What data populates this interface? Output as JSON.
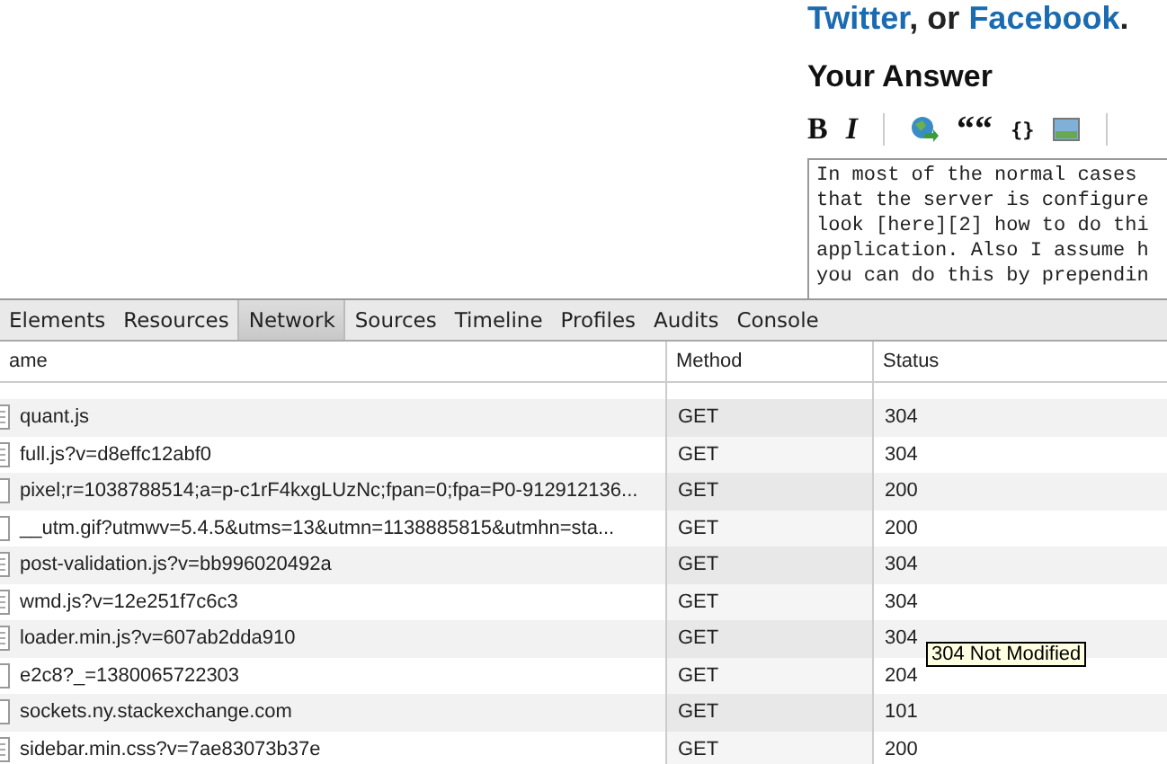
{
  "page": {
    "share_links": [
      {
        "text": "Twitter"
      },
      {
        "text": ", or "
      },
      {
        "text": "Facebook"
      },
      {
        "text": "."
      }
    ],
    "heading": "Your Answer",
    "toolbar": [
      {
        "kind": "bold",
        "label": "B"
      },
      {
        "kind": "italic",
        "label": "I"
      },
      {
        "kind": "separator"
      },
      {
        "kind": "link"
      },
      {
        "kind": "quote",
        "label": "“"
      },
      {
        "kind": "code",
        "label": "{}"
      },
      {
        "kind": "image"
      },
      {
        "kind": "separator"
      }
    ],
    "answer_lines": [
      "In most of the normal cases",
      "that the server is configure",
      "look [here][2] how to do thi",
      "application. Also I assume h",
      "you can do this by prependin"
    ]
  },
  "devtools": {
    "tabs": [
      {
        "label": "Elements",
        "selected": false
      },
      {
        "label": "Resources",
        "selected": false
      },
      {
        "label": "Network",
        "selected": true
      },
      {
        "label": "Sources",
        "selected": false
      },
      {
        "label": "Timeline",
        "selected": false
      },
      {
        "label": "Profiles",
        "selected": false
      },
      {
        "label": "Audits",
        "selected": false
      },
      {
        "label": "Console",
        "selected": false
      }
    ],
    "columns": [
      "ame",
      "Method",
      "Status"
    ],
    "rows": [
      {
        "kind": "script",
        "name": "quant.js",
        "method": "GET",
        "status": "304"
      },
      {
        "kind": "script",
        "name": "full.js?v=d8effc12abf0",
        "method": "GET",
        "status": "304"
      },
      {
        "kind": "other",
        "name": "pixel;r=1038788514;a=p-c1rF4kxgLUzNc;fpan=0;fpa=P0-912912136...",
        "method": "GET",
        "status": "200"
      },
      {
        "kind": "other",
        "name": "__utm.gif?utmwv=5.4.5&utms=13&utmn=1138885815&utmhn=sta...",
        "method": "GET",
        "status": "200"
      },
      {
        "kind": "script",
        "name": "post-validation.js?v=bb996020492a",
        "method": "GET",
        "status": "304"
      },
      {
        "kind": "script",
        "name": "wmd.js?v=12e251f7c6c3",
        "method": "GET",
        "status": "304"
      },
      {
        "kind": "script",
        "name": "loader.min.js?v=607ab2dda910",
        "method": "GET",
        "status": "304"
      },
      {
        "kind": "other",
        "name": "e2c8?_=1380065722303",
        "method": "GET",
        "status": "204"
      },
      {
        "kind": "other",
        "name": "sockets.ny.stackexchange.com",
        "method": "GET",
        "status": "101"
      },
      {
        "kind": "script",
        "name": "sidebar.min.css?v=7ae83073b37e",
        "method": "GET",
        "status": "200"
      }
    ],
    "tooltip": "304 Not Modified"
  }
}
